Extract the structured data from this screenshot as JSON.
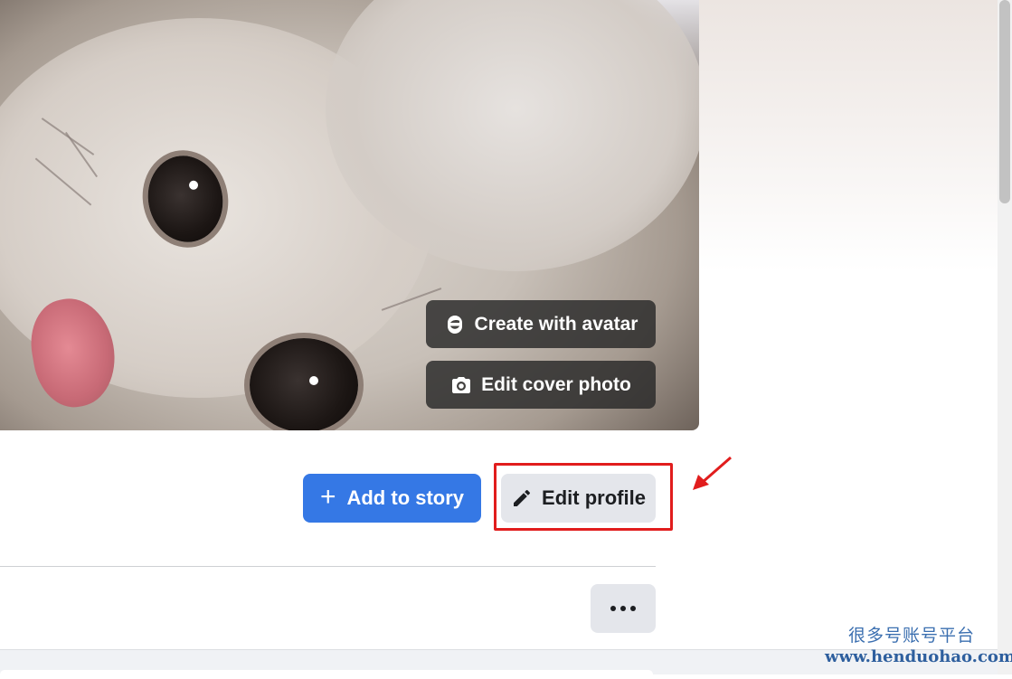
{
  "cover": {
    "create_avatar_label": "Create with avatar",
    "edit_cover_label": "Edit cover photo"
  },
  "actions": {
    "add_story_label": "Add to story",
    "edit_profile_label": "Edit profile",
    "more_icon": "more-horizontal-icon"
  },
  "colors": {
    "primary": "#3578e5",
    "secondary_button": "#e4e6eb",
    "highlight": "#e11d1d"
  },
  "watermark": {
    "chinese": "很多号账号平台",
    "url": "www.henduohao.com"
  }
}
